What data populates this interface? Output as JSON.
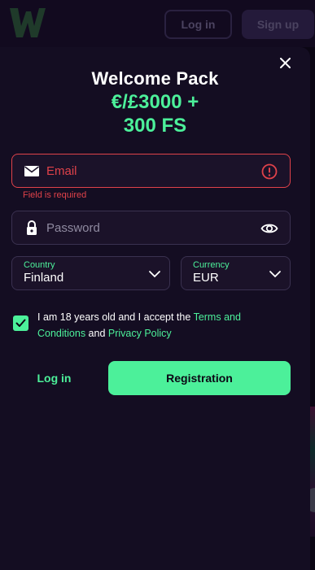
{
  "background": {
    "login_label": "Log in",
    "signup_label": "Sign up"
  },
  "modal": {
    "title": "Welcome Pack",
    "promo_line1": "€/£3000 +",
    "promo_line2": "300 FS",
    "email": {
      "placeholder": "Email",
      "error": "Field is required"
    },
    "password": {
      "placeholder": "Password"
    },
    "country": {
      "label": "Country",
      "value": "Finland"
    },
    "currency": {
      "label": "Currency",
      "value": "EUR"
    },
    "consent": {
      "text_before": "I am 18 years old and I accept the ",
      "terms_link": "Terms and Conditions",
      "text_middle": " and ",
      "privacy_link": "Privacy Policy",
      "checked": true
    },
    "login_label": "Log in",
    "register_label": "Registration"
  },
  "colors": {
    "accent": "#4cf09a",
    "error": "#e0424a",
    "background": "#0b0614",
    "modal": "#140d22",
    "field": "#1b1229"
  },
  "icons": [
    "logo-icon",
    "close-icon",
    "envelope-icon",
    "error-icon",
    "lock-icon",
    "eye-icon",
    "chevron-down-icon",
    "checkmark-icon"
  ]
}
